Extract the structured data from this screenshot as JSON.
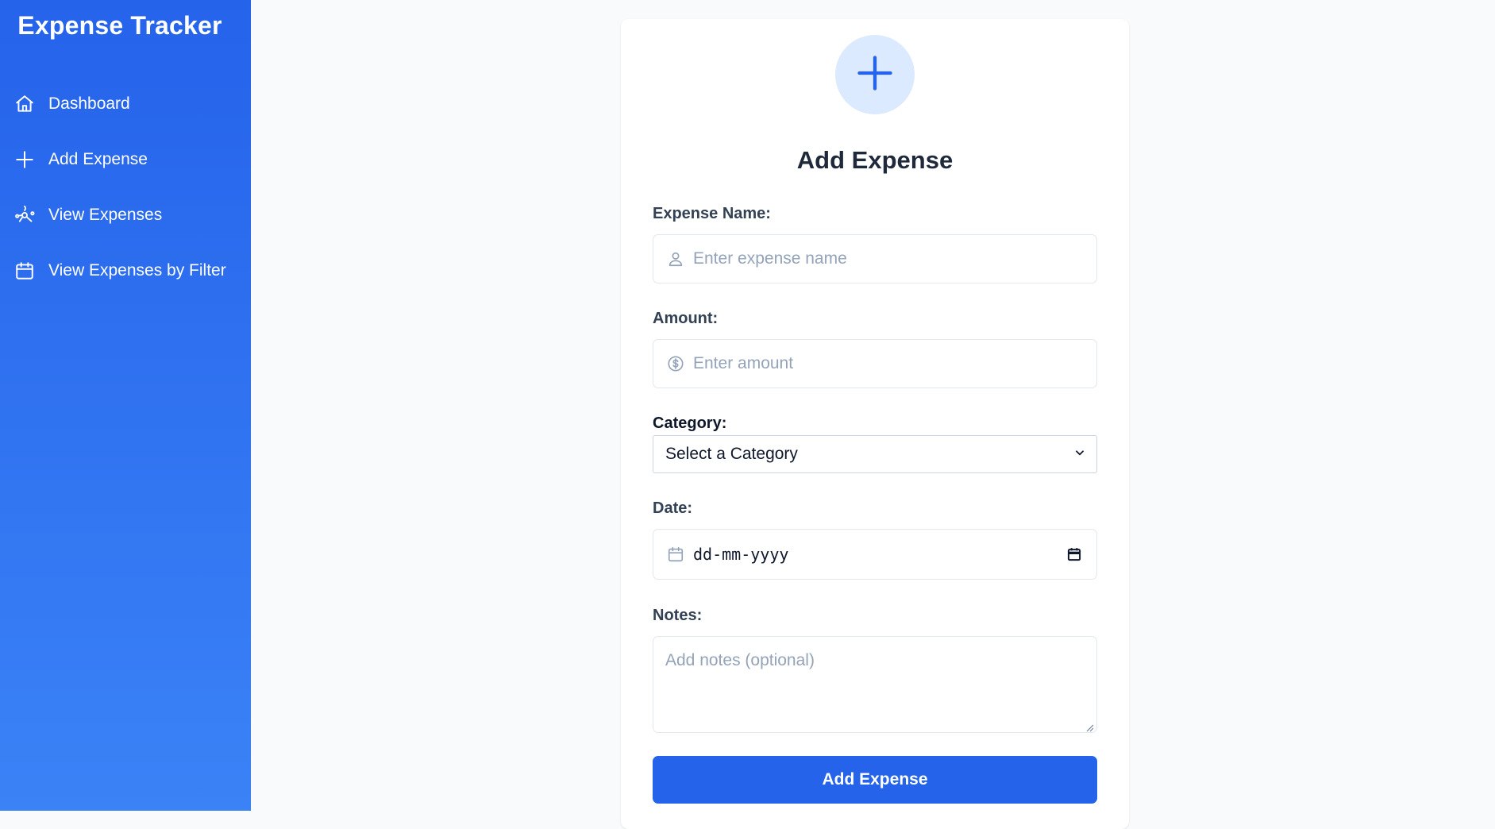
{
  "app": {
    "title": "Expense Tracker"
  },
  "sidebar": {
    "items": [
      {
        "label": "Dashboard",
        "icon": "home-icon"
      },
      {
        "label": "Add Expense",
        "icon": "plus-icon"
      },
      {
        "label": "View Expenses",
        "icon": "expenses-list-icon"
      },
      {
        "label": "View Expenses by Filter",
        "icon": "calendar-icon"
      }
    ]
  },
  "form": {
    "hero_icon": "plus-icon",
    "title": "Add Expense",
    "name": {
      "label": "Expense Name:",
      "placeholder": "Enter expense name",
      "value": "",
      "icon": "user-icon"
    },
    "amount": {
      "label": "Amount:",
      "placeholder": "Enter amount",
      "value": "",
      "icon": "dollar-circle-icon"
    },
    "category": {
      "label": "Category:",
      "selected": "Select a Category"
    },
    "date": {
      "label": "Date:",
      "value": "dd-mm-yyyy",
      "icon": "calendar-icon"
    },
    "notes": {
      "label": "Notes:",
      "placeholder": "Add notes (optional)",
      "value": ""
    },
    "submit_label": "Add Expense"
  },
  "colors": {
    "sidebar_top": "#2563eb",
    "sidebar_bottom": "#3b82f6",
    "primary": "#2563eb",
    "hero_bg": "#dbeafe",
    "page_bg": "#f8fafc"
  }
}
